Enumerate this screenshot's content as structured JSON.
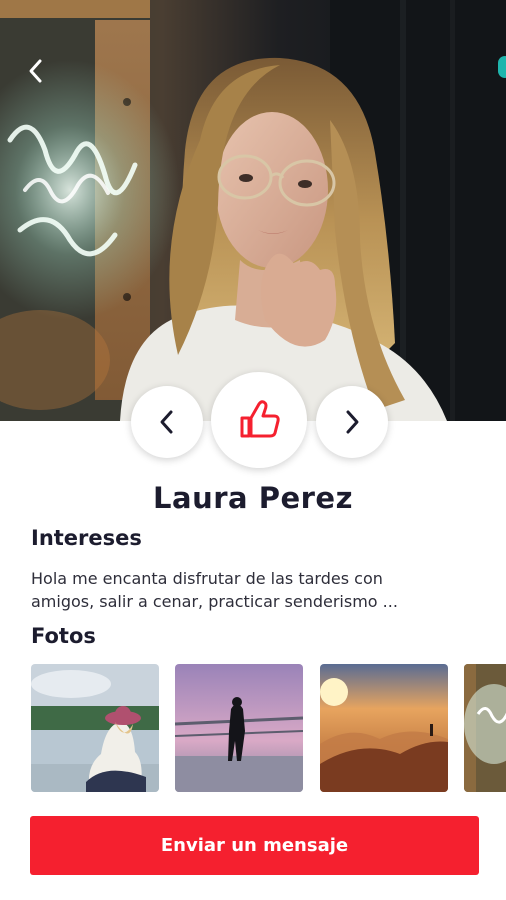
{
  "profile": {
    "name": "Laura Perez",
    "interests_title": "Intereses",
    "bio": "Hola me encanta disfrutar de las tardes con amigos, salir a cenar,  practicar senderismo ...",
    "photos_title": "Fotos"
  },
  "actions": {
    "back_icon": "chevron-left-icon",
    "prev_icon": "chevron-left-icon",
    "like_icon": "thumbs-up-icon",
    "next_icon": "chevron-right-icon",
    "message_button": "Enviar un mensaje"
  },
  "colors": {
    "accent": "#f5202f",
    "text": "#1c1c2e",
    "background": "#ffffff"
  },
  "photos": [
    {
      "subject": "woman in hat sitting by lake"
    },
    {
      "subject": "person on bridge at dusk"
    },
    {
      "subject": "sunset over mountains"
    },
    {
      "subject": "neon sign wall"
    }
  ]
}
